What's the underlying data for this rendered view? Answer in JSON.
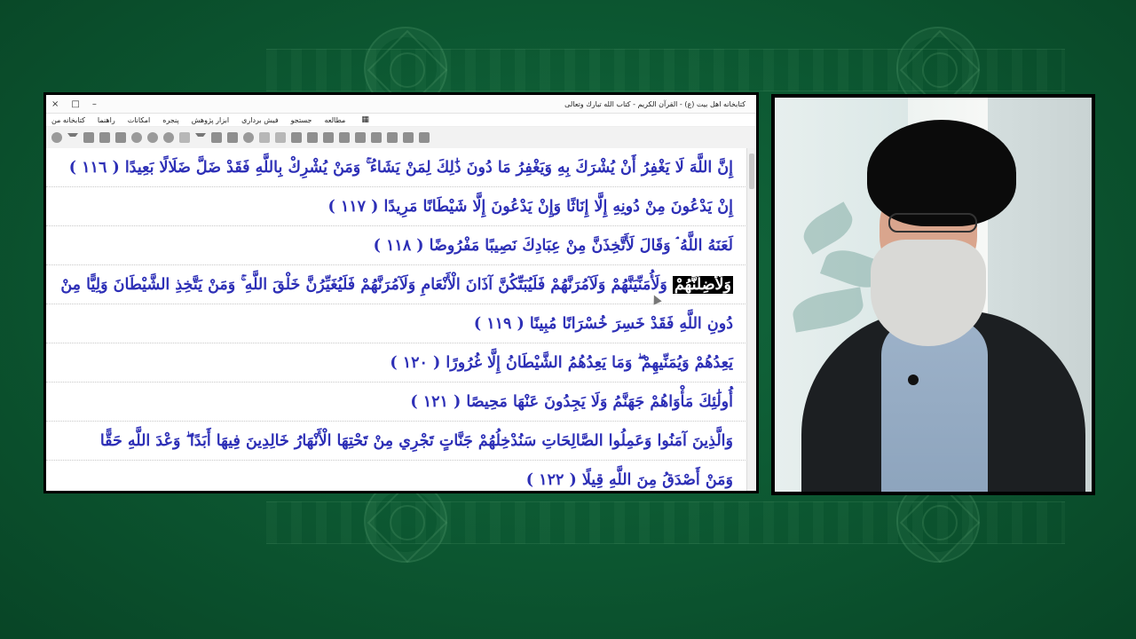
{
  "window": {
    "title": "کتابخانه اهل بیت (ع) - القرآن الکریم - کتاب الله تبارك وتعالى",
    "controls": {
      "close": "×",
      "maximize": "□",
      "minimize": "–"
    }
  },
  "menu": [
    "مطالعه",
    "جستجو",
    "فیش برداری",
    "ابزار پژوهش",
    "پنجره",
    "امکانات",
    "راهنما",
    "کتابخانه من"
  ],
  "verses": [
    {
      "text": "إِنَّ اللَّهَ لَا يَغْفِرُ أَنْ يُشْرَكَ بِهِ وَيَغْفِرُ مَا دُونَ ذَٰلِكَ لِمَنْ يَشَاءُ ۚ وَمَنْ يُشْرِكْ بِاللَّهِ فَقَدْ ضَلَّ ضَلَالًا بَعِيدًا ( ١١٦ )"
    },
    {
      "text": "إِنْ يَدْعُونَ مِنْ دُونِهِ إِلَّا إِنَاثًا وَإِنْ يَدْعُونَ إِلَّا شَيْطَانًا مَرِيدًا ( ١١٧ )"
    },
    {
      "text": "لَعَنَهُ اللَّهُ ۘ وَقَالَ لَأَتَّخِذَنَّ مِنْ عِبَادِكَ نَصِيبًا مَفْرُوضًا ( ١١٨ )"
    },
    {
      "highlight": "وَلَأُضِلَّنَّهُمْ",
      "text": " وَلَأُمَنِّيَنَّهُمْ وَلَآمُرَنَّهُمْ فَلَيُبَتِّكُنَّ آذَانَ الْأَنْعَامِ وَلَآمُرَنَّهُمْ فَلَيُغَيِّرُنَّ خَلْقَ اللَّهِ ۚ وَمَنْ يَتَّخِذِ الشَّيْطَانَ وَلِيًّا مِنْ"
    },
    {
      "text": "دُونِ اللَّهِ فَقَدْ خَسِرَ خُسْرَانًا مُبِينًا ( ١١٩ )"
    },
    {
      "text": "يَعِدُهُمْ وَيُمَنِّيهِمْ ۖ وَمَا يَعِدُهُمُ الشَّيْطَانُ إِلَّا غُرُورًا ( ١٢٠ )"
    },
    {
      "text": "أُولَٰئِكَ مَأْوَاهُمْ جَهَنَّمُ وَلَا يَجِدُونَ عَنْهَا مَحِيصًا ( ١٢١ )"
    },
    {
      "text": "وَالَّذِينَ آمَنُوا وَعَمِلُوا الصَّالِحَاتِ سَنُدْخِلُهُمْ جَنَّاتٍ تَجْرِي مِنْ تَحْتِهَا الْأَنْهَارُ خَالِدِينَ فِيهَا أَبَدًا ۖ وَعْدَ اللَّهِ حَقًّا"
    },
    {
      "text": "وَمَنْ أَصْدَقُ مِنَ اللَّهِ قِيلًا ( ١٢٢ )"
    }
  ]
}
